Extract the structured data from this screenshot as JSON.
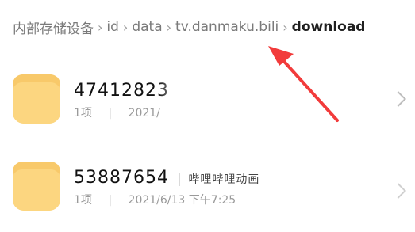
{
  "breadcrumb": {
    "items": [
      "内部存储设备",
      "id",
      "data",
      "tv.danmaku.bili",
      "download"
    ],
    "separator": "›"
  },
  "folders": [
    {
      "name": "47412823",
      "subtitle": "",
      "items_count": "1项",
      "date": "2021/"
    },
    {
      "name": "53887654",
      "subtitle": "哔哩哔哩动画",
      "items_count": "1项",
      "date": "2021/6/13 下午7:25"
    }
  ],
  "colors": {
    "folder": "#fbd07a",
    "annotation_arrow": "#f23b3b"
  },
  "icons": {
    "folder": "folder-icon",
    "chevron": "chevron-right-icon",
    "annotation": "annotation-arrow"
  }
}
